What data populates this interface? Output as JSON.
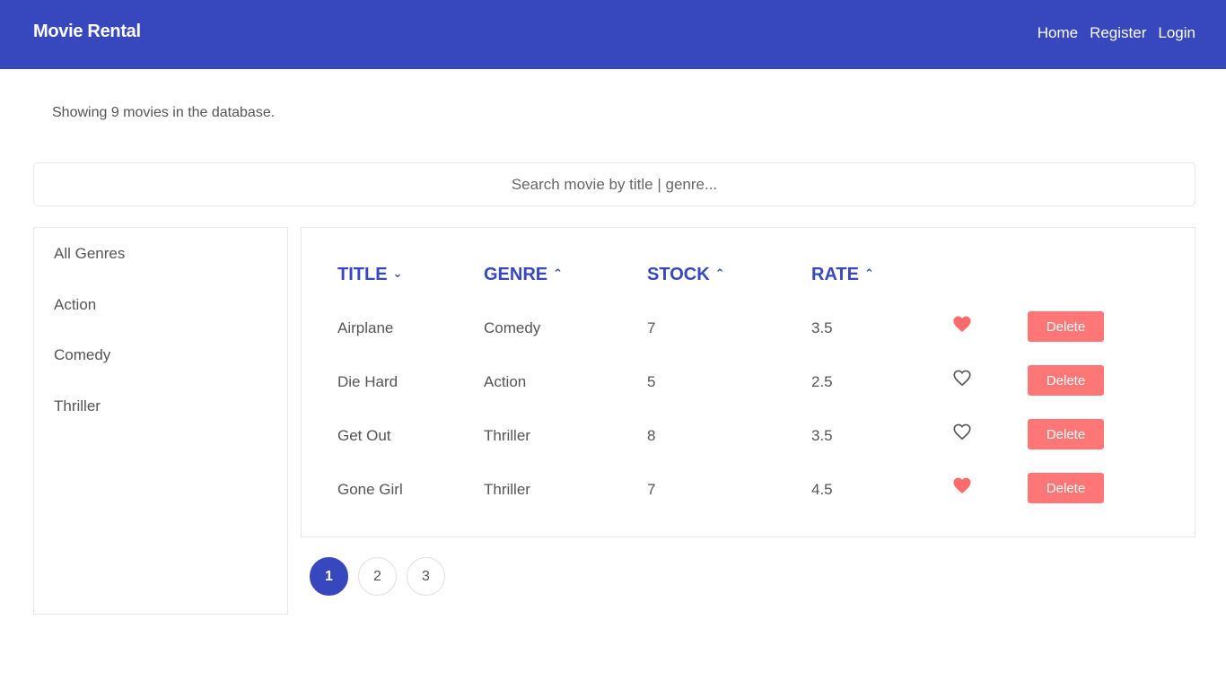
{
  "navbar": {
    "brand": "Movie Rental",
    "links": [
      "Home",
      "Register",
      "Login"
    ]
  },
  "summary": "Showing 9 movies in the database.",
  "search": {
    "placeholder": "Search movie by title | genre...",
    "value": ""
  },
  "genres": [
    "All Genres",
    "Action",
    "Comedy",
    "Thriller"
  ],
  "table": {
    "columns": [
      {
        "label": "TITLE",
        "sort_icon": "chevron-down-icon",
        "caret": "⌄"
      },
      {
        "label": "GENRE",
        "sort_icon": "chevron-up-icon",
        "caret": "⌃"
      },
      {
        "label": "STOCK",
        "sort_icon": "chevron-up-icon",
        "caret": "⌃"
      },
      {
        "label": "RATE",
        "sort_icon": "chevron-up-icon",
        "caret": "⌃"
      }
    ],
    "rows": [
      {
        "title": "Airplane",
        "genre": "Comedy",
        "stock": "7",
        "rate": "3.5",
        "liked": true
      },
      {
        "title": "Die Hard",
        "genre": "Action",
        "stock": "5",
        "rate": "2.5",
        "liked": false
      },
      {
        "title": "Get Out",
        "genre": "Thriller",
        "stock": "8",
        "rate": "3.5",
        "liked": false
      },
      {
        "title": "Gone Girl",
        "genre": "Thriller",
        "stock": "7",
        "rate": "4.5",
        "liked": true
      }
    ],
    "delete_label": "Delete"
  },
  "pagination": {
    "pages": [
      "1",
      "2",
      "3"
    ],
    "current": "1"
  },
  "colors": {
    "brand": "#3747bd",
    "delete": "#ff7676",
    "heart_filled": "#ff6b6b",
    "heart_outline": "#555555"
  }
}
